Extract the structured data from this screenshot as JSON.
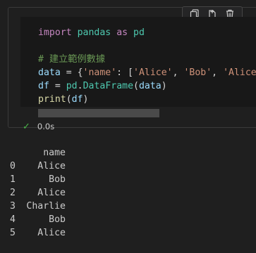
{
  "toolbar": {
    "icons": [
      "copy-icon",
      "split-icon",
      "delete-icon"
    ]
  },
  "code": {
    "line1": {
      "kw1": "import",
      "mod1": "pandas",
      "kw2": "as",
      "mod2": "pd"
    },
    "line3": "# 建立範例數據",
    "line4": {
      "var": "data",
      "op": " = {",
      "key": "'name'",
      "sep": ": [",
      "s1": "'Alice'",
      "c1": ", ",
      "s2": "'Bob'",
      "c2": ", ",
      "s3": "'Alice'",
      "tail": ","
    },
    "line5": {
      "var": "df",
      "op": " = ",
      "mod": "pd",
      "dot": ".",
      "fn": "DataFrame",
      "open": "(",
      "arg": "data",
      "close": ")"
    },
    "line6": {
      "fn": "print",
      "open": "(",
      "arg": "df",
      "close": ")"
    }
  },
  "status": {
    "time": "0.0s"
  },
  "output": {
    "header": "name",
    "rows": [
      {
        "index": "0",
        "value": "Alice"
      },
      {
        "index": "1",
        "value": "Bob"
      },
      {
        "index": "2",
        "value": "Alice"
      },
      {
        "index": "3",
        "value": "Charlie"
      },
      {
        "index": "4",
        "value": "Bob"
      },
      {
        "index": "5",
        "value": "Alice"
      }
    ]
  },
  "colors": {
    "background": "#1f1f1f",
    "editor": "#181818",
    "success": "#4bb74a"
  }
}
